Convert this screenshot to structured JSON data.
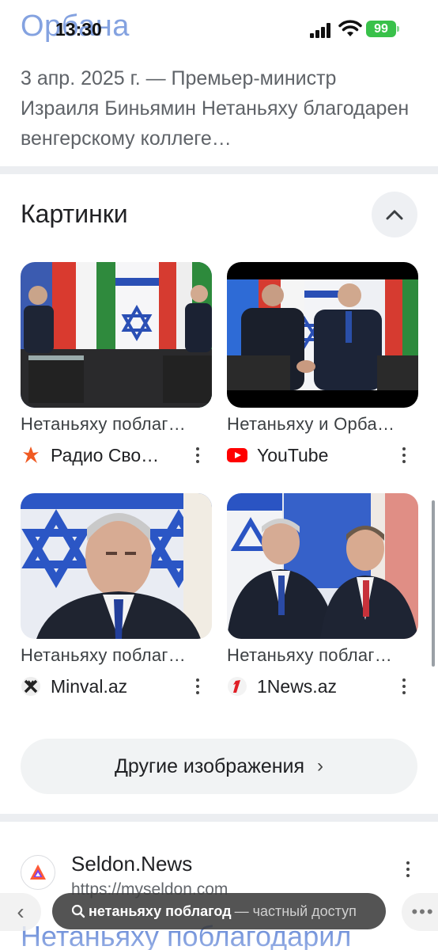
{
  "status_bar": {
    "time": "13:30",
    "battery": "99"
  },
  "top_result": {
    "title_fragment": "Орбана",
    "snippet": "3 апр. 2025 г. — Премьер-министр Израиля Биньямин Нетаньяху благодарен венгерскому коллеге…"
  },
  "images_section": {
    "title": "Картинки",
    "cards": [
      {
        "caption": "Нетаньяху поблаг…",
        "source": "Радио Сво…",
        "icon": "radio-svoboda-icon"
      },
      {
        "caption": "Нетаньяху и Орба…",
        "source": "YouTube",
        "icon": "youtube-icon"
      },
      {
        "caption": "Нетаньяху поблаг…",
        "source": "Minval.az",
        "icon": "minval-icon"
      },
      {
        "caption": "Нетаньяху поблаг…",
        "source": "1News.az",
        "icon": "1news-icon"
      }
    ],
    "more_button": "Другие изображения"
  },
  "second_result": {
    "site_name": "Seldon.News",
    "url": "https://myseldon.com",
    "title": "Нетаньяху поблагодарил"
  },
  "bottom_bar": {
    "query": "нетаньяху поблагод",
    "mode": "— частный доступ"
  },
  "colors": {
    "link": "#1a4fc4",
    "youtube": "#ff0000",
    "battery": "#39c14a"
  }
}
